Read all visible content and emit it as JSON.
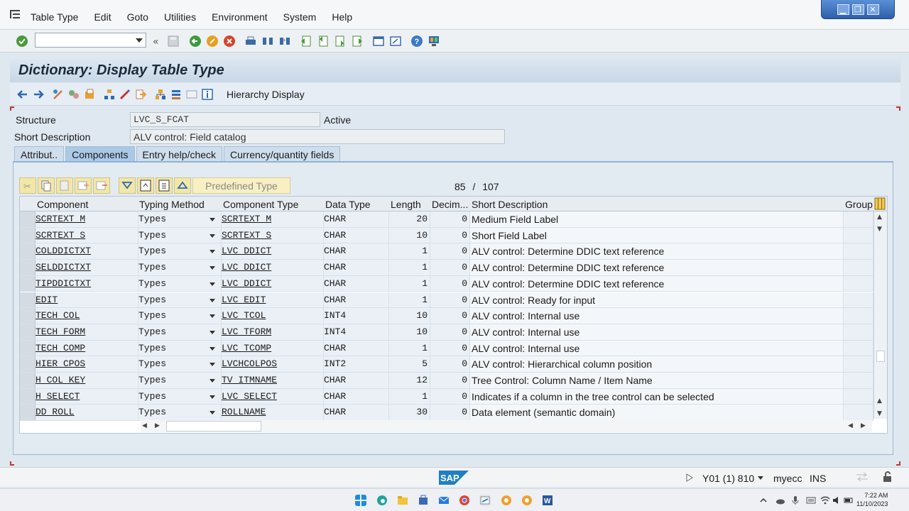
{
  "menu": [
    "Table Type",
    "Edit",
    "Goto",
    "Utilities",
    "Environment",
    "System",
    "Help"
  ],
  "window_buttons": {
    "minimize": "▁",
    "restore": "❐",
    "close": "✕"
  },
  "toolbar": {
    "command_field_value": "",
    "icons": [
      "enter-icon",
      "command-field",
      "collapse-icon",
      "save-icon",
      "back-icon",
      "exit-icon",
      "cancel-icon",
      "print-icon",
      "find-icon",
      "find-next-icon",
      "first-page-icon",
      "previous-page-icon",
      "next-page-icon",
      "last-page-icon",
      "create-session-icon",
      "shortcut-icon",
      "help-icon",
      "customize-layout-icon"
    ]
  },
  "title": "Dictionary: Display Table Type",
  "app_toolbar": {
    "hierarchy_label": "Hierarchy Display"
  },
  "header": {
    "structure_label": "Structure",
    "structure_value": "LVC_S_FCAT",
    "status": "Active",
    "short_desc_label": "Short Description",
    "short_desc_value": "ALV control: Field catalog"
  },
  "tabs": [
    {
      "label": "Attribut..",
      "active": false
    },
    {
      "label": "Components",
      "active": true
    },
    {
      "label": "Entry help/check",
      "active": false
    },
    {
      "label": "Currency/quantity fields",
      "active": false
    }
  ],
  "table_controls": {
    "predefined_type_label": "Predefined Type",
    "position": "85",
    "separator": "/",
    "total": "107"
  },
  "columns": [
    "Component",
    "Typing Method",
    "Component Type",
    "Data Type",
    "Length",
    "Decim...",
    "Short Description",
    "Group"
  ],
  "rows": [
    {
      "component": "SCRTEXT_M",
      "typing": "Types",
      "ctype": "SCRTEXT_M",
      "dtype": "CHAR",
      "length": "20",
      "dec": "0",
      "desc": "Medium Field Label"
    },
    {
      "component": "SCRTEXT_S",
      "typing": "Types",
      "ctype": "SCRTEXT_S",
      "dtype": "CHAR",
      "length": "10",
      "dec": "0",
      "desc": "Short Field Label"
    },
    {
      "component": "COLDDICTXT",
      "typing": "Types",
      "ctype": "LVC_DDICT",
      "dtype": "CHAR",
      "length": "1",
      "dec": "0",
      "desc": "ALV control: Determine DDIC text reference"
    },
    {
      "component": "SELDDICTXT",
      "typing": "Types",
      "ctype": "LVC_DDICT",
      "dtype": "CHAR",
      "length": "1",
      "dec": "0",
      "desc": "ALV control: Determine DDIC text reference"
    },
    {
      "component": "TIPDDICTXT",
      "typing": "Types",
      "ctype": "LVC_DDICT",
      "dtype": "CHAR",
      "length": "1",
      "dec": "0",
      "desc": "ALV control: Determine DDIC text reference"
    },
    {
      "component": "EDIT",
      "typing": "Types",
      "ctype": "LVC_EDIT",
      "dtype": "CHAR",
      "length": "1",
      "dec": "0",
      "desc": "ALV control: Ready for input"
    },
    {
      "component": "TECH_COL",
      "typing": "Types",
      "ctype": "LVC_TCOL",
      "dtype": "INT4",
      "length": "10",
      "dec": "0",
      "desc": "ALV control: Internal use"
    },
    {
      "component": "TECH_FORM",
      "typing": "Types",
      "ctype": "LVC_TFORM",
      "dtype": "INT4",
      "length": "10",
      "dec": "0",
      "desc": "ALV control: Internal use"
    },
    {
      "component": "TECH_COMP",
      "typing": "Types",
      "ctype": "LVC_TCOMP",
      "dtype": "CHAR",
      "length": "1",
      "dec": "0",
      "desc": "ALV control: Internal use"
    },
    {
      "component": "HIER_CPOS",
      "typing": "Types",
      "ctype": "LVCHCOLPOS",
      "dtype": "INT2",
      "length": "5",
      "dec": "0",
      "desc": "ALV control: Hierarchical column position"
    },
    {
      "component": "H_COL_KEY",
      "typing": "Types",
      "ctype": "TV_ITMNAME",
      "dtype": "CHAR",
      "length": "12",
      "dec": "0",
      "desc": "Tree Control: Column Name / Item Name"
    },
    {
      "component": "H_SELECT",
      "typing": "Types",
      "ctype": "LVC_SELECT",
      "dtype": "CHAR",
      "length": "1",
      "dec": "0",
      "desc": "Indicates if a column in the tree control can be selected"
    },
    {
      "component": "DD_ROLL",
      "typing": "Types",
      "ctype": "ROLLNAME",
      "dtype": "CHAR",
      "length": "30",
      "dec": "0",
      "desc": "Data element (semantic domain)"
    }
  ],
  "status_bar": {
    "system": "Y01 (1) 810",
    "server": "myecc",
    "mode": "INS",
    "logo": "SAP"
  },
  "taskbar": {
    "time": "7:22 AM",
    "date": "11/10/2023"
  },
  "colors": {
    "accent": "#8fb3d6",
    "title_bg": "#c8d7e6",
    "table_btn": "#f2e7a6",
    "frame_corner": "#c0392b"
  }
}
